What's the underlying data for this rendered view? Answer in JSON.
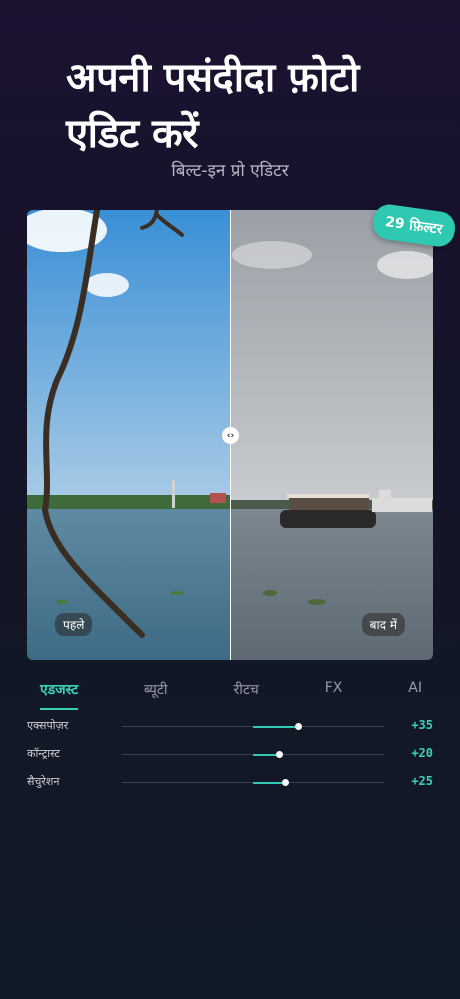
{
  "header": {
    "title": "अपनी पसंदीदा फ़ोटो एडिट करें",
    "subtitle": "बिल्ट-इन प्रो एडिटर"
  },
  "preview": {
    "before_label": "पहले",
    "after_label": "बाद में",
    "filter_badge": "29 फ़िल्टर"
  },
  "tabs": [
    {
      "label": "एडजस्ट",
      "active": true
    },
    {
      "label": "ब्यूटी",
      "active": false
    },
    {
      "label": "रीटच",
      "active": false
    },
    {
      "label": "FX",
      "active": false
    },
    {
      "label": "AI",
      "active": false
    }
  ],
  "sliders": [
    {
      "label": "एक्सपोज़र",
      "value_text": "+35",
      "value": 35
    },
    {
      "label": "कॉन्ट्रास्ट",
      "value_text": "+20",
      "value": 20
    },
    {
      "label": "सैचुरेशन",
      "value_text": "+25",
      "value": 25
    }
  ],
  "colors": {
    "accent": "#2ec9b0",
    "background": "#141428"
  }
}
